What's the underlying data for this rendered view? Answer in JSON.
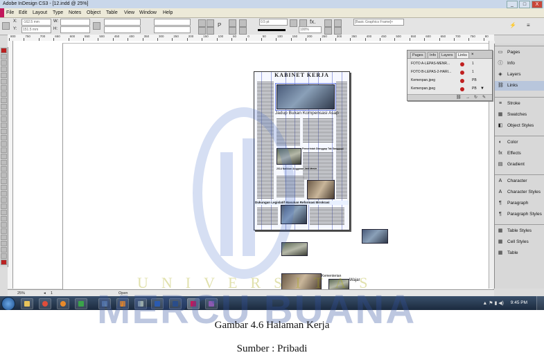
{
  "window": {
    "title": "Adobe InDesign CS3 - [12.indd @ 25%]",
    "min": "_",
    "max": "□",
    "close": "X"
  },
  "menu": [
    "File",
    "Edit",
    "Layout",
    "Type",
    "Notes",
    "Object",
    "Table",
    "View",
    "Window",
    "Help"
  ],
  "control_panel": {
    "x_label": "X:",
    "x_value": "-162.5 mm",
    "y_label": "Y:",
    "y_value": "151.5 mm",
    "w_label": "W:",
    "h_label": "H:",
    "stroke_weight": "0.5 pt",
    "opacity": "100%",
    "object_style": "[Basic Graphics Frame]+"
  },
  "ruler_numbers": [
    "800",
    "750",
    "700",
    "650",
    "600",
    "550",
    "500",
    "450",
    "400",
    "350",
    "300",
    "250",
    "200",
    "150",
    "100",
    "50",
    "0",
    "50",
    "100",
    "150",
    "200",
    "250",
    "300",
    "350",
    "400",
    "450",
    "500",
    "550",
    "600",
    "650",
    "700",
    "750",
    "80"
  ],
  "document": {
    "masthead": "KABINET KERJA",
    "headline": "Jadup Bukan Kompensasi Asap",
    "subhead_1": "Pemerintah Dianggap Tak Sanggupi",
    "subhead_2": "2014 Naikkan Anggaran Jadi Mesin",
    "caption": "Dukungan Legislatif Masukan Reformasi Birokrasi",
    "side_text_1": "Kementerian",
    "side_text_2": "Wajar"
  },
  "links_panel": {
    "tabs": [
      "Pages",
      "Info",
      "Layers",
      "Links"
    ],
    "tab_close": "×",
    "items": [
      {
        "name": "FOTO A-LEPAS-MENR...",
        "page": "1",
        "flag": ""
      },
      {
        "name": "FOTO B-LEPAS-2-HARI...",
        "page": "1",
        "flag": ""
      },
      {
        "name": "Kemenpan.jpeg",
        "page": "PB",
        "flag": ""
      },
      {
        "name": "Kemenpan.jpeg",
        "page": "PB",
        "flag": "▼"
      }
    ]
  },
  "dock": {
    "group1": [
      {
        "icon": "pages-icon",
        "label": "Pages"
      },
      {
        "icon": "info-icon",
        "label": "Info"
      },
      {
        "icon": "layers-icon",
        "label": "Layers"
      },
      {
        "icon": "links-icon",
        "label": "Links"
      }
    ],
    "group2": [
      {
        "icon": "stroke-icon",
        "label": "Stroke"
      },
      {
        "icon": "swatches-icon",
        "label": "Swatches"
      },
      {
        "icon": "object-styles-icon",
        "label": "Object Styles"
      }
    ],
    "group3": [
      {
        "icon": "color-icon",
        "label": "Color"
      },
      {
        "icon": "effects-icon",
        "label": "Effects"
      },
      {
        "icon": "gradient-icon",
        "label": "Gradient"
      }
    ],
    "group4": [
      {
        "icon": "character-icon",
        "label": "Character"
      },
      {
        "icon": "character-styles-icon",
        "label": "Character Styles"
      },
      {
        "icon": "paragraph-icon",
        "label": "Paragraph"
      },
      {
        "icon": "paragraph-styles-icon",
        "label": "Paragraph Styles"
      }
    ],
    "group5": [
      {
        "icon": "table-styles-icon",
        "label": "Table Styles"
      },
      {
        "icon": "cell-styles-icon",
        "label": "Cell Styles"
      },
      {
        "icon": "table-icon",
        "label": "Table"
      }
    ]
  },
  "status": {
    "zoom": "25%",
    "page": "1",
    "open": "Open"
  },
  "taskbar": {
    "time": "9:45 PM"
  },
  "watermark": {
    "univ": "UNIVERSITAS",
    "mercu": "MERCU BUANA"
  },
  "figure": {
    "caption": "Gambar 4.6 Halaman Kerja",
    "source": "Sumber : Pribadi"
  },
  "colors": {
    "accent": "#c2185b",
    "taskbar": "#1b2a3e",
    "selected": "#b8c6dc",
    "link_status": "#c02020"
  }
}
